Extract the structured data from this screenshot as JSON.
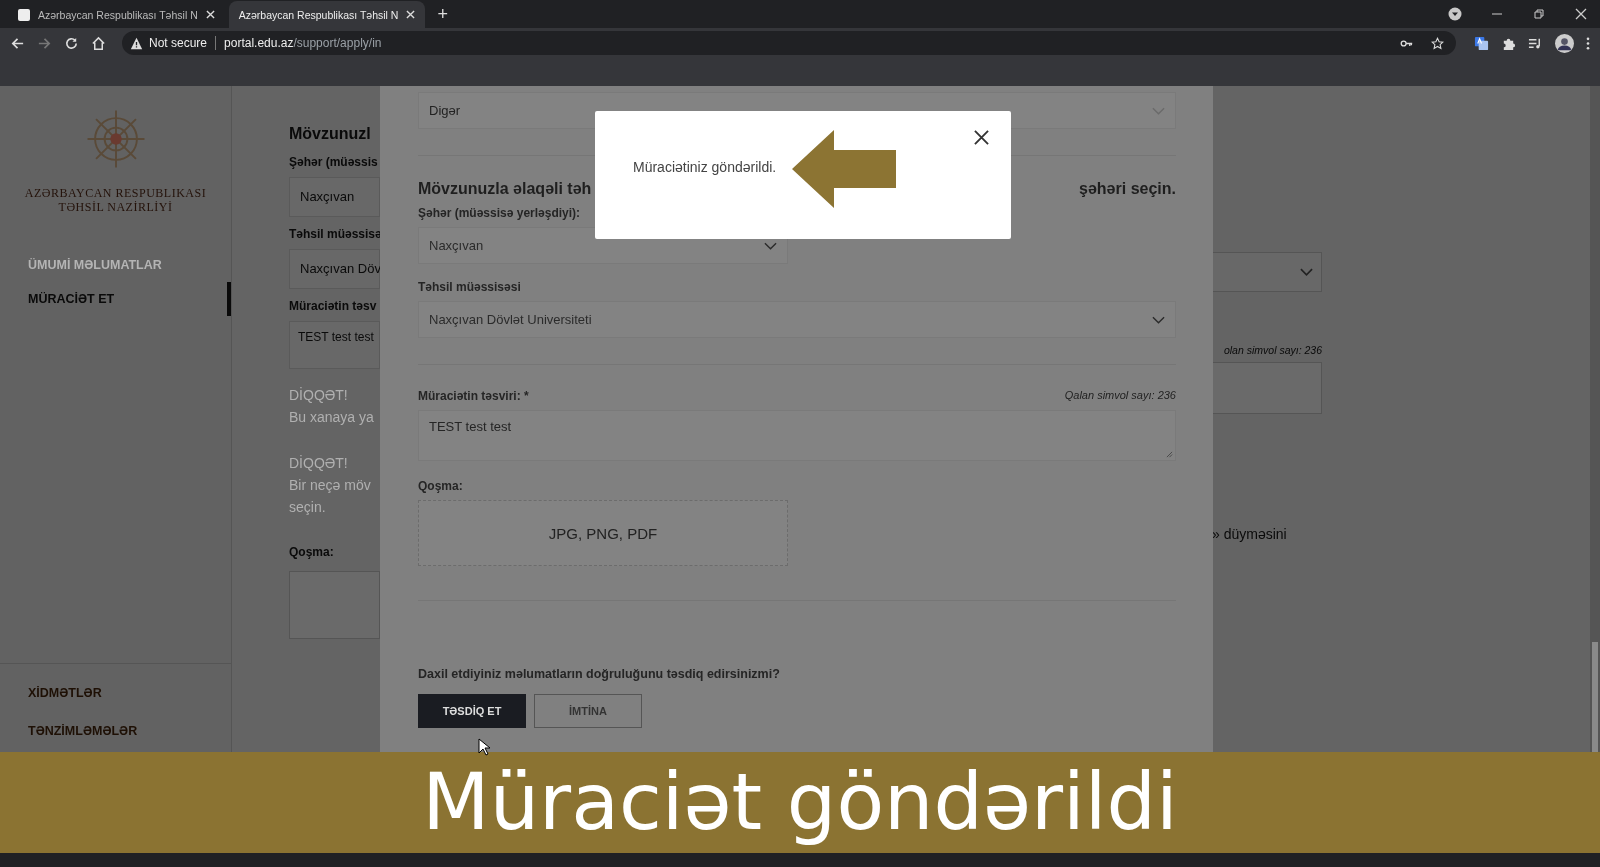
{
  "browser": {
    "tabs": [
      {
        "title": "Azərbaycan Respublikası Təhsil N",
        "selected": false
      },
      {
        "title": "Azərbaycan Respublikası Təhsil N",
        "selected": true
      }
    ],
    "new_tab": "+",
    "security": "Not secure",
    "url_host": "portal.edu.az",
    "url_path": "/support/apply/in"
  },
  "sidebar": {
    "org_name": [
      "AZƏRBAYCAN RESPUBLIKASI",
      "TƏHSİL NAZİRLİYİ"
    ],
    "nav": [
      {
        "label": "ÜMUMİ MƏLUMATLAR",
        "selected": false
      },
      {
        "label": "MÜRACİƏT ET",
        "selected": true
      }
    ],
    "footer_nav": [
      "XİDMƏTLƏR",
      "TƏNZİMLƏMƏLƏR"
    ]
  },
  "background_page": {
    "left_items": [
      {
        "kind": "heading",
        "text": "Mövzunuzl"
      },
      {
        "kind": "label",
        "text": "Şəhər (müəssis"
      },
      {
        "kind": "select",
        "text": "Naxçıvan"
      },
      {
        "kind": "label",
        "text": "Təhsil müəssisə"
      },
      {
        "kind": "select",
        "text": "Naxçıvan Döv"
      },
      {
        "kind": "label",
        "text": "Müraciətin təsv"
      },
      {
        "kind": "textarea",
        "text": "TEST test test"
      },
      {
        "kind": "notice_title",
        "text": "DİQQƏT!"
      },
      {
        "kind": "notice",
        "text": "Bu xanaya ya"
      },
      {
        "kind": "notice_title",
        "text": "DİQQƏT!"
      },
      {
        "kind": "notice",
        "text": "Bir neçə möv"
      },
      {
        "kind": "notice",
        "text": "seçin."
      },
      {
        "kind": "label",
        "text": "Qoşma:"
      },
      {
        "kind": "dropzone"
      }
    ],
    "right_counter": "olan simvol sayı: 236",
    "right_notice": "» düyməsini"
  },
  "modal_form": {
    "top_select": "Digər",
    "heading_start": "Mövzunuzla əlaqəli təh",
    "heading_end": "şəhəri seçin.",
    "city_label": "Şəhər (müəssisə yerləşdiyi):",
    "city_value": "Naxçıvan",
    "institution_label": "Təhsil müəssisəsi",
    "institution_value": "Naxçıvan Dövlət Universiteti",
    "description_label": "Müraciətin təsviri: *",
    "counter": "Qalan simvol sayı: 236",
    "description_value": "TEST test test",
    "attachment_label": "Qoşma:",
    "attachment_hint": "JPG, PNG, PDF",
    "confirm_question": "Daxil etdiyiniz məlumatların doğruluğunu təsdiq edirsinizmi?",
    "buttons": [
      {
        "label": "TƏSDİQ ET",
        "kind": "primary"
      },
      {
        "label": "İMTİNA",
        "kind": "secondary"
      }
    ]
  },
  "alert": {
    "message": "Müraciətiniz göndərildi."
  },
  "caption": "Müraciət göndərildi"
}
